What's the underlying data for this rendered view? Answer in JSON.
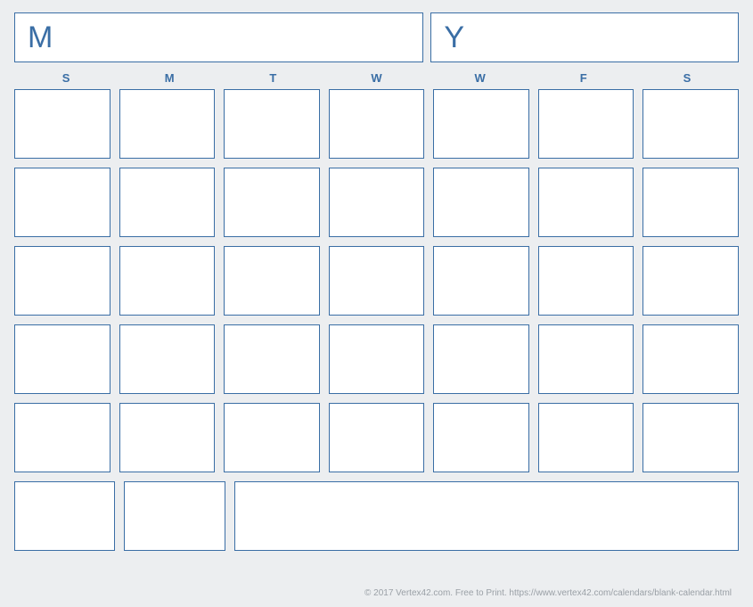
{
  "header": {
    "month_label": "M",
    "year_label": "Y"
  },
  "weekdays": [
    "S",
    "M",
    "T",
    "W",
    "W",
    "F",
    "S"
  ],
  "footer": {
    "text": "© 2017 Vertex42.com. Free to Print. https://www.vertex42.com/calendars/blank-calendar.html"
  }
}
